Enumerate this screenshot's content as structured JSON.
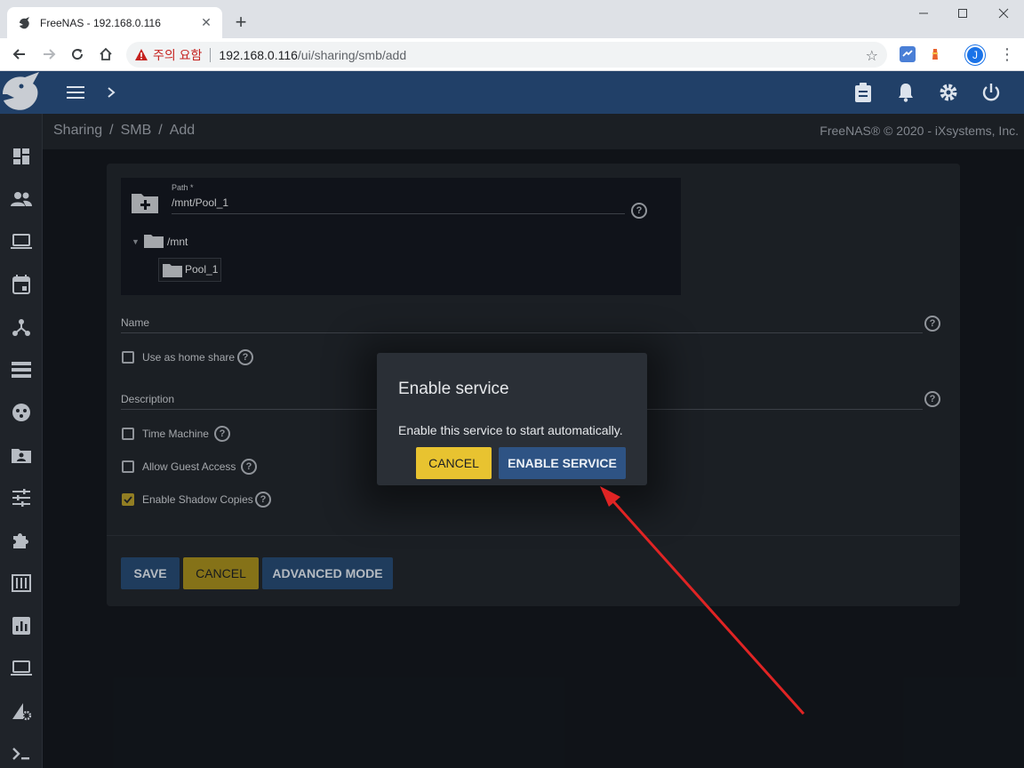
{
  "browser": {
    "tab_title": "FreeNAS - 192.168.0.116",
    "warning_text": "주의 요함",
    "url_host": "192.168.0.116",
    "url_path": "/ui/sharing/smb/add",
    "avatar_letter": "J"
  },
  "breadcrumb": {
    "items": [
      "Sharing",
      "SMB",
      "Add"
    ],
    "separator": "/"
  },
  "copyright": "FreeNAS® © 2020 - iXsystems, Inc.",
  "form": {
    "path_label": "Path *",
    "path_value": "/mnt/Pool_1",
    "tree_root": "/mnt",
    "tree_child": "Pool_1",
    "name_label": "Name",
    "description_label": "Description",
    "home_share_label": "Use as home share",
    "time_machine_label": "Time Machine",
    "guest_access_label": "Allow Guest Access",
    "shadow_copies_label": "Enable Shadow Copies",
    "shadow_copies_checked": true
  },
  "buttons": {
    "save": "SAVE",
    "cancel": "CANCEL",
    "advanced": "ADVANCED MODE"
  },
  "dialog": {
    "title": "Enable service",
    "message": "Enable this service to start automatically.",
    "cancel": "CANCEL",
    "confirm": "ENABLE SERVICE"
  },
  "colors": {
    "appbar": "#214068",
    "primary_button": "#264a72",
    "accent_button": "#e8c330",
    "annotation_arrow": "#e02424"
  }
}
